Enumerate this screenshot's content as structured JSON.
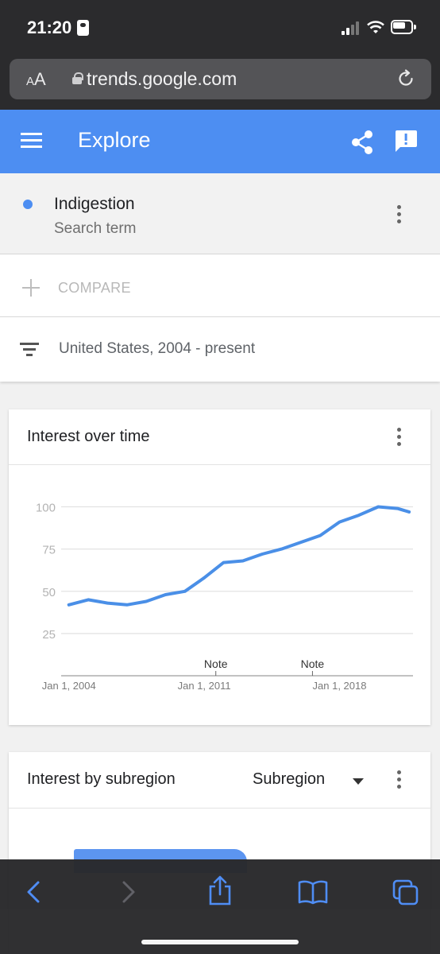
{
  "status_bar": {
    "time": "21:20"
  },
  "browser": {
    "text_size_label_small": "A",
    "text_size_label_large": "A",
    "url": "trends.google.com"
  },
  "header": {
    "title": "Explore"
  },
  "search_term": {
    "name": "Indigestion",
    "type": "Search term",
    "color": "#4d8ef2"
  },
  "compare": {
    "label": "COMPARE"
  },
  "filter": {
    "text": "United States, 2004 - present"
  },
  "interest_over_time": {
    "title": "Interest over time",
    "chart_data": {
      "type": "line",
      "y_ticks": [
        100,
        75,
        50,
        25
      ],
      "ylim": [
        0,
        100
      ],
      "x_ticks": [
        "Jan 1, 2004",
        "Jan 1, 2011",
        "Jan 1, 2018"
      ],
      "notes": [
        {
          "label": "Note",
          "x": 2011.6
        },
        {
          "label": "Note",
          "x": 2016.6
        }
      ],
      "series": [
        {
          "color": "#4a8fe7",
          "x": [
            2004.0,
            2005.0,
            2006.0,
            2007.0,
            2008.0,
            2009.0,
            2010.0,
            2011.0,
            2012.0,
            2013.0,
            2014.0,
            2015.0,
            2016.0,
            2017.0,
            2018.0,
            2019.0,
            2020.0,
            2021.0,
            2021.6
          ],
          "values": [
            42,
            45,
            43,
            42,
            44,
            48,
            50,
            58,
            67,
            68,
            72,
            75,
            79,
            83,
            91,
            95,
            100,
            99,
            97
          ]
        }
      ]
    }
  },
  "interest_by_subregion": {
    "title": "Interest by subregion",
    "select_value": "Subregion"
  }
}
